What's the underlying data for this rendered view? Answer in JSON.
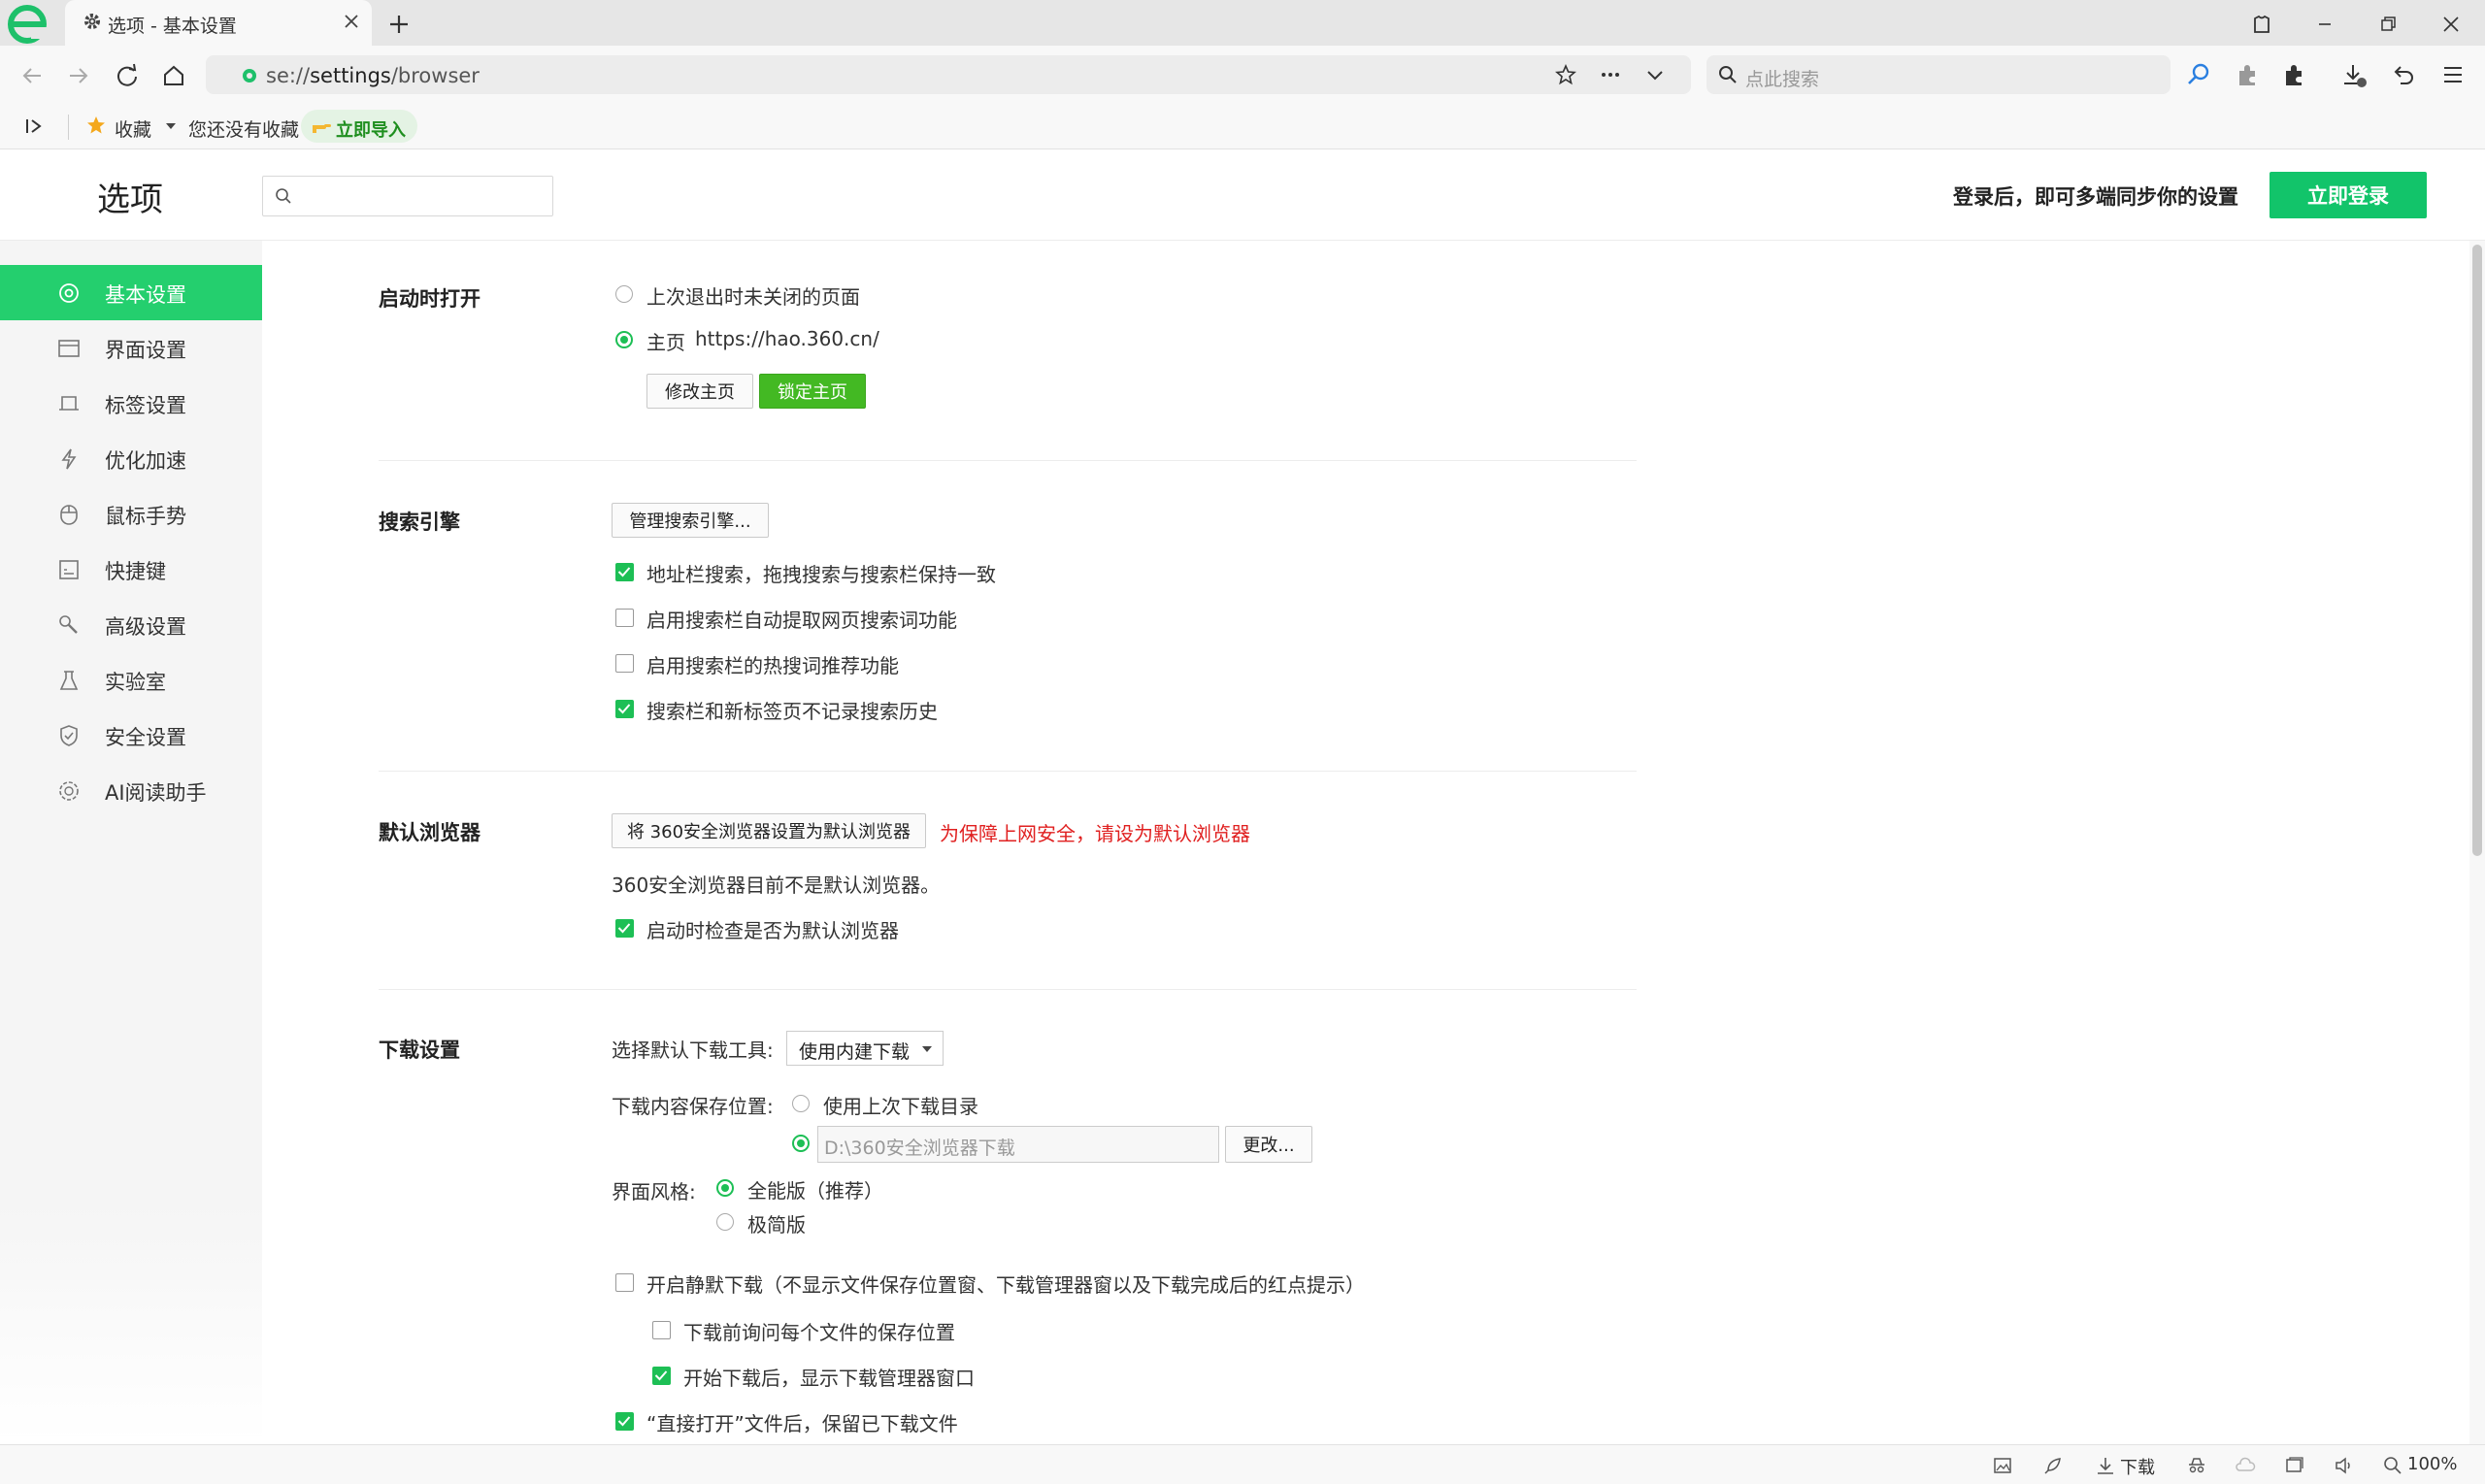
{
  "browser": {
    "tab": {
      "title": "选项 - 基本设置"
    },
    "address": {
      "scheme": "se://",
      "host": "settings",
      "path": "/browser"
    },
    "search": {
      "placeholder": "点此搜索"
    }
  },
  "bookmarks_bar": {
    "favorites_label": "收藏",
    "empty_text": "您还没有收藏",
    "import_label": "立即导入"
  },
  "header": {
    "title": "选项",
    "search_placeholder": "",
    "sync_text": "登录后，即可多端同步你的设置",
    "login_button": "立即登录"
  },
  "sidebar": {
    "items": [
      {
        "label": "基本设置",
        "icon": "target-icon",
        "active": true
      },
      {
        "label": "界面设置",
        "icon": "window-icon"
      },
      {
        "label": "标签设置",
        "icon": "tab-icon"
      },
      {
        "label": "优化加速",
        "icon": "lightning-icon"
      },
      {
        "label": "鼠标手势",
        "icon": "mouse-icon"
      },
      {
        "label": "快捷键",
        "icon": "keyboard-icon"
      },
      {
        "label": "高级设置",
        "icon": "wrench-icon"
      },
      {
        "label": "实验室",
        "icon": "flask-icon"
      },
      {
        "label": "安全设置",
        "icon": "shield-icon"
      },
      {
        "label": "AI阅读助手",
        "icon": "ai-icon"
      }
    ]
  },
  "startup": {
    "title": "启动时打开",
    "option_restore": "上次退出时未关闭的页面",
    "option_home": "主页",
    "home_url": "https://hao.360.cn/",
    "modify_button": "修改主页",
    "lock_button": "锁定主页"
  },
  "search_engine": {
    "title": "搜索引擎",
    "manage_button": "管理搜索引擎...",
    "options": [
      {
        "label": "地址栏搜索，拖拽搜索与搜索栏保持一致",
        "checked": true
      },
      {
        "label": "启用搜索栏自动提取网页搜索词功能",
        "checked": false
      },
      {
        "label": "启用搜索栏的热搜词推荐功能",
        "checked": false
      },
      {
        "label": "搜索栏和新标签页不记录搜索历史",
        "checked": true
      }
    ]
  },
  "default_browser": {
    "title": "默认浏览器",
    "set_button": "将 360安全浏览器设置为默认浏览器",
    "warning": "为保障上网安全，请设为默认浏览器",
    "status": "360安全浏览器目前不是默认浏览器。",
    "check_label": "启动时检查是否为默认浏览器"
  },
  "download": {
    "title": "下载设置",
    "tool_label": "选择默认下载工具:",
    "tool_value": "使用内建下载",
    "location_label": "下载内容保存位置:",
    "use_last": "使用上次下载目录",
    "path": "D:\\360安全浏览器下载",
    "change_button": "更改...",
    "style_label": "界面风格:",
    "style_full": "全能版（推荐）",
    "style_simple": "极简版",
    "silent": "开启静默下载（不显示文件保存位置窗、下载管理器窗以及下载完成后的红点提示）",
    "ask_location": "下载前询问每个文件的保存位置",
    "show_manager": "开始下载后，显示下载管理器窗口",
    "keep_file": "“直接打开”文件后，保留已下载文件"
  },
  "statusbar": {
    "download_label": "下载",
    "zoom": "100%"
  },
  "colors": {
    "accent": "#12c46a",
    "sidebar_active": "#24cf6e",
    "lock_button": "#43b923",
    "warning": "#e02020"
  }
}
